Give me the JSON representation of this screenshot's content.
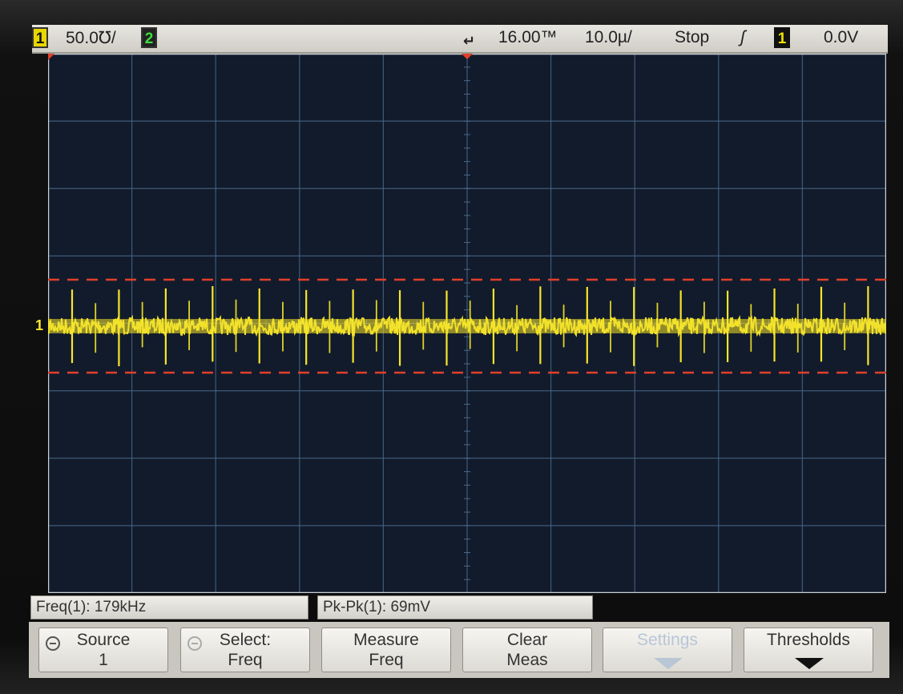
{
  "status": {
    "ch1_badge": "1",
    "ch1_scale": "50.0℧/",
    "ch2_badge": "2",
    "trigger_marker": "↵",
    "delay": "16.00™",
    "timebase": "10.0µ/",
    "run_state": "Stop",
    "trigger_edge": "ʃ",
    "trigger_source_badge": "1",
    "trigger_level": "0.0V"
  },
  "measurements": {
    "freq": "Freq(1): 179kHz",
    "pkpk": "Pk-Pk(1): 69mV"
  },
  "softkeys": [
    {
      "line1": "Source",
      "line2": "1"
    },
    {
      "line1": "Select:",
      "line2": "Freq"
    },
    {
      "line1": "Measure",
      "line2": "Freq"
    },
    {
      "line1": "Clear",
      "line2": "Meas"
    },
    {
      "line1": "Settings",
      "line2": ""
    },
    {
      "line1": "Thresholds",
      "line2": ""
    }
  ],
  "ground_marker": "1",
  "colors": {
    "trace": "#f7e62a",
    "cursor": "#e0402a",
    "grid": "#4a6a8a",
    "screen": "#121b2c"
  },
  "waveform": {
    "channel": "1",
    "frequency_khz": 179,
    "peak_to_peak_mv": 69,
    "timebase_us_per_div": 10,
    "volts_per_div_mv": 50
  }
}
